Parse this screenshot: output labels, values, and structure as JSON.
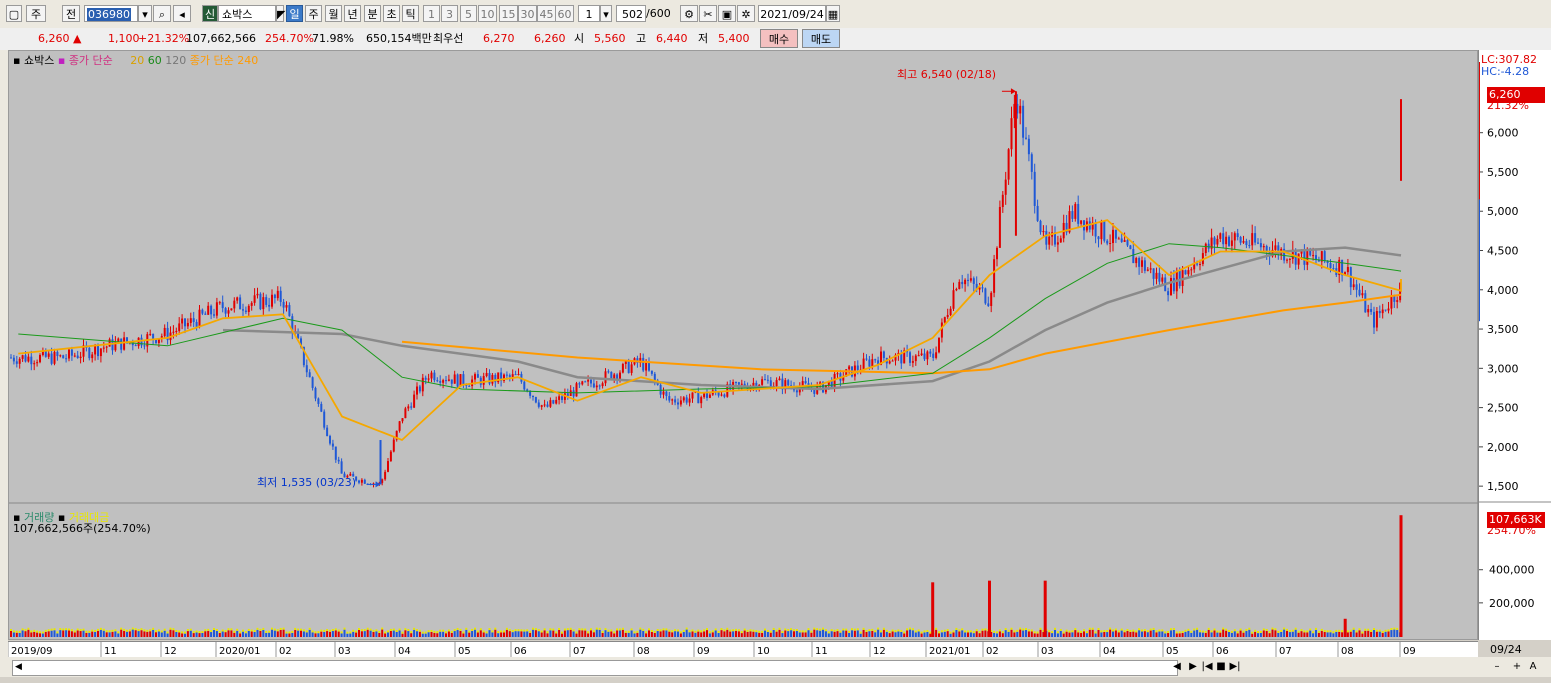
{
  "toolbar": {
    "period_label": "주",
    "prev_label": "전",
    "stock_code": "036980",
    "market_badge": "신",
    "stock_name": "쇼박스",
    "periods": [
      "일",
      "주",
      "월",
      "년",
      "분",
      "초",
      "틱"
    ],
    "intervals": [
      "1",
      "3",
      "5",
      "10",
      "15",
      "30",
      "45",
      "60"
    ],
    "interval_value": "1",
    "count_value": "502",
    "count_total": "/600",
    "date_value": "2021/09/24"
  },
  "quote": {
    "price": "6,260",
    "change": "1,100",
    "change_rate": "+21.32%",
    "volume": "107,662,566",
    "volume_rate": "254.70%",
    "ratio": "71.98%",
    "amount": "650,154백만",
    "best_label": "최우선",
    "best_ask": "6,270",
    "best_bid": "6,260",
    "open_label": "시",
    "open": "5,560",
    "high_label": "고",
    "high": "6,440",
    "low_label": "저",
    "low": "5,400",
    "buy_label": "매수",
    "sell_label": "매도"
  },
  "legend": {
    "name": "쇼박스",
    "ma_label": "종가 단순",
    "ma_periods": [
      "20",
      "60",
      "120"
    ],
    "ma_long": "종가 단순 240",
    "volume_label": "거래량",
    "amount_label": "거래대금",
    "volume_text": "107,662,566주(254.70%)"
  },
  "annotations": {
    "high_text": "최고 6,540 (02/18)",
    "low_text": "최저 1,535 (03/23)"
  },
  "right_axis": {
    "lc": "LC:307.82",
    "hc": "HC:-4.28",
    "price_tag": "6,260",
    "price_pct": "21.32%",
    "vol_tag": "107,663K",
    "vol_pct": "254.70%"
  },
  "bottom": {
    "right_date": "09/24",
    "controls": [
      "◀",
      "▶",
      "|◀",
      "■",
      "▶|",
      "–",
      "+",
      "A"
    ]
  },
  "colors": {
    "up": "#e00000",
    "down": "#1f58d6",
    "ma20": "#f5a800",
    "ma60": "#1a9a1a",
    "ma120": "#8a8a8a",
    "ma240": "#ff9a00",
    "background": "#c0c0c0"
  },
  "chart_data": {
    "type": "candlestick",
    "x_labels": [
      "2019/09",
      "11",
      "12",
      "2020/01",
      "02",
      "03",
      "04",
      "05",
      "06",
      "07",
      "08",
      "09",
      "10",
      "11",
      "12",
      "2021/01",
      "02",
      "03",
      "04",
      "05",
      "06",
      "07",
      "08",
      "09"
    ],
    "y_ticks": [
      1500,
      2000,
      2500,
      3000,
      3500,
      4000,
      4500,
      5000,
      5500,
      6000
    ],
    "y_tick_labels": [
      "1,500",
      "2,000",
      "2,500",
      "3,000",
      "3,500",
      "4,000",
      "4,500",
      "5,000",
      "5,500",
      "6,000"
    ],
    "ylim": [
      1400,
      6900
    ],
    "volume_ticks": [
      200000,
      400000
    ],
    "volume_tick_labels": [
      "200,000",
      "400,000"
    ],
    "volume_ylim": [
      0,
      700000
    ],
    "close_points": [
      [
        "2019/09",
        3150
      ],
      [
        "2019/10",
        3150
      ],
      [
        "2019/11",
        3300
      ],
      [
        "2019/12",
        3450
      ],
      [
        "2020/01",
        3800
      ],
      [
        "2020/02",
        3900
      ],
      [
        "2020/03",
        1650
      ],
      [
        "2020/03/23",
        1535
      ],
      [
        "2020/04",
        2400
      ],
      [
        "2020/04b",
        2950
      ],
      [
        "2020/05",
        2850
      ],
      [
        "2020/06",
        2900
      ],
      [
        "2020/06b",
        2500
      ],
      [
        "2020/07",
        2750
      ],
      [
        "2020/08",
        3100
      ],
      [
        "2020/08b",
        2600
      ],
      [
        "2020/09",
        2650
      ],
      [
        "2020/10",
        2850
      ],
      [
        "2020/11",
        2750
      ],
      [
        "2020/12",
        3150
      ],
      [
        "2021/01",
        3150
      ],
      [
        "2021/01b",
        4200
      ],
      [
        "2021/02",
        3900
      ],
      [
        "2021/02/18",
        6540
      ],
      [
        "2021/03",
        4500
      ],
      [
        "2021/03b",
        5000
      ],
      [
        "2021/04",
        4700
      ],
      [
        "2021/05",
        4050
      ],
      [
        "2021/06",
        4700
      ],
      [
        "2021/07",
        4500
      ],
      [
        "2021/08",
        4300
      ],
      [
        "2021/08b",
        3600
      ],
      [
        "2021/09",
        4050
      ],
      [
        "2021/09/24",
        6260
      ]
    ],
    "ma20_points": [
      [
        "2019/09",
        3200
      ],
      [
        "2019/12",
        3400
      ],
      [
        "2020/01",
        3650
      ],
      [
        "2020/02",
        3700
      ],
      [
        "2020/03",
        2400
      ],
      [
        "2020/04",
        2100
      ],
      [
        "2020/05",
        2800
      ],
      [
        "2020/06",
        2900
      ],
      [
        "2020/07",
        2600
      ],
      [
        "2020/08",
        2900
      ],
      [
        "2020/09",
        2700
      ],
      [
        "2020/11",
        2800
      ],
      [
        "2020/12",
        3050
      ],
      [
        "2021/01",
        3400
      ],
      [
        "2021/02",
        4200
      ],
      [
        "2021/03",
        4700
      ],
      [
        "2021/04",
        4900
      ],
      [
        "2021/05",
        4200
      ],
      [
        "2021/06",
        4500
      ],
      [
        "2021/07",
        4500
      ],
      [
        "2021/08",
        4200
      ],
      [
        "2021/09",
        4000
      ],
      [
        "2021/09/24",
        4150
      ]
    ],
    "ma60_points": [
      [
        "2019/09",
        3450
      ],
      [
        "2019/12",
        3300
      ],
      [
        "2020/02",
        3650
      ],
      [
        "2020/03",
        3500
      ],
      [
        "2020/04",
        2900
      ],
      [
        "2020/05",
        2750
      ],
      [
        "2020/07",
        2700
      ],
      [
        "2020/09",
        2750
      ],
      [
        "2020/11",
        2780
      ],
      [
        "2021/01",
        2950
      ],
      [
        "2021/02",
        3400
      ],
      [
        "2021/03",
        3900
      ],
      [
        "2021/04",
        4350
      ],
      [
        "2021/05",
        4600
      ],
      [
        "2021/06",
        4550
      ],
      [
        "2021/07",
        4450
      ],
      [
        "2021/08",
        4350
      ],
      [
        "2021/09",
        4250
      ]
    ],
    "ma120_points": [
      [
        "2020/01",
        3500
      ],
      [
        "2020/03",
        3450
      ],
      [
        "2020/04",
        3300
      ],
      [
        "2020/06",
        3100
      ],
      [
        "2020/07",
        2900
      ],
      [
        "2020/09",
        2800
      ],
      [
        "2020/11",
        2750
      ],
      [
        "2021/01",
        2850
      ],
      [
        "2021/02",
        3100
      ],
      [
        "2021/03",
        3500
      ],
      [
        "2021/04",
        3850
      ],
      [
        "2021/05",
        4100
      ],
      [
        "2021/07",
        4500
      ],
      [
        "2021/08",
        4550
      ],
      [
        "2021/09",
        4450
      ]
    ],
    "ma240_points": [
      [
        "2020/04",
        3350
      ],
      [
        "2020/07",
        3150
      ],
      [
        "2020/10",
        3000
      ],
      [
        "2021/01",
        2950
      ],
      [
        "2021/02",
        3000
      ],
      [
        "2021/03",
        3200
      ],
      [
        "2021/05",
        3500
      ],
      [
        "2021/07",
        3750
      ],
      [
        "2021/08",
        3850
      ],
      [
        "2021/09",
        3950
      ]
    ],
    "volume_spikes": [
      [
        "2021/01",
        330000
      ],
      [
        "2021/02",
        340000
      ],
      [
        "2021/03",
        340000
      ],
      [
        "2021/08",
        110000
      ],
      [
        "2021/09/24",
        1200000
      ]
    ]
  }
}
